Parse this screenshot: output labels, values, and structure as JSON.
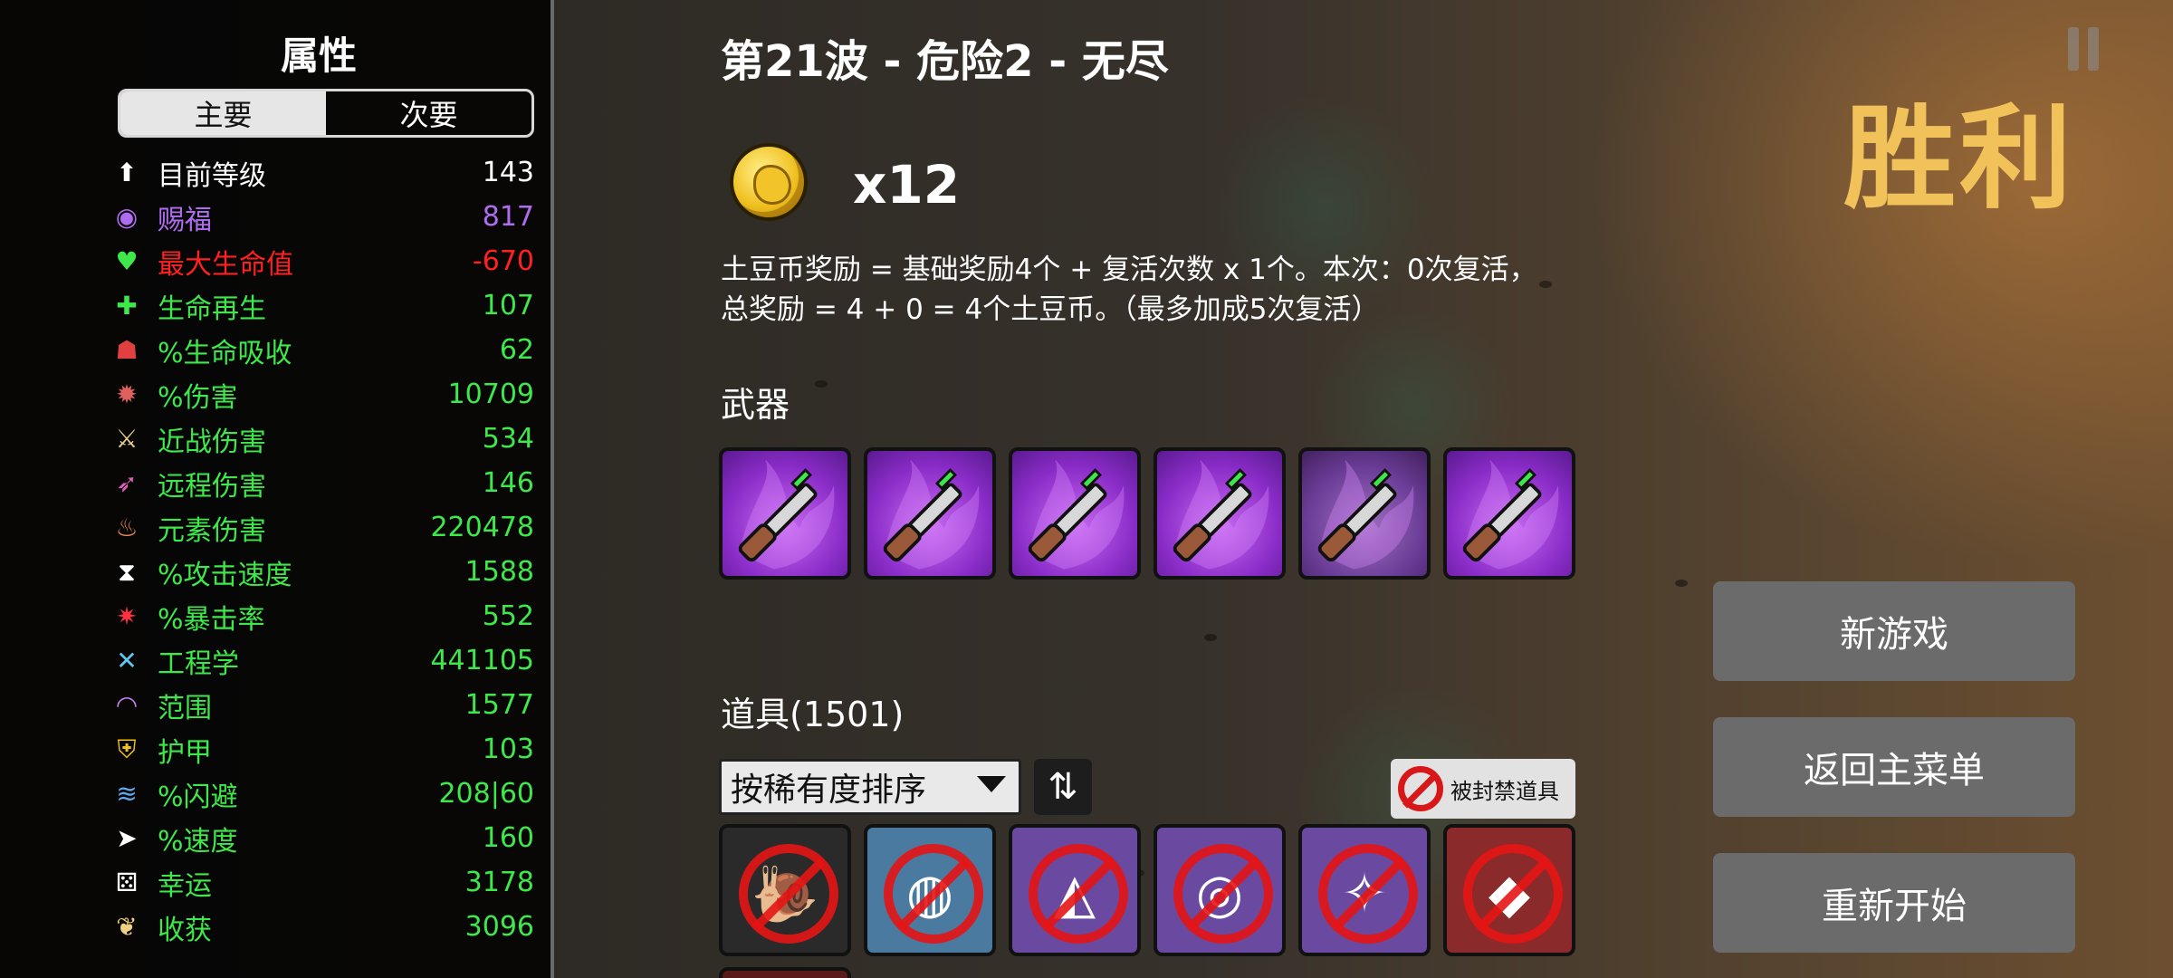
{
  "stats_panel": {
    "title": "属性",
    "tabs": [
      "主要",
      "次要"
    ],
    "stats": [
      {
        "icon": "level-icon",
        "glyph": "⬆",
        "name": "目前等级",
        "value": "143",
        "color": "#ffffff",
        "icon_color": "#ffffff"
      },
      {
        "icon": "eye-icon",
        "glyph": "◉",
        "name": "赐福",
        "value": "817",
        "color": "#b06cf0",
        "icon_color": "#b06cf0"
      },
      {
        "icon": "heart-icon",
        "glyph": "♥",
        "name": "最大生命值",
        "value": "-670",
        "color": "#ff2020",
        "icon_color": "#3ee84a"
      },
      {
        "icon": "regen-icon",
        "glyph": "✚",
        "name": "生命再生",
        "value": "107",
        "color": "#3ee84a",
        "icon_color": "#3ee84a"
      },
      {
        "icon": "lifesteal-icon",
        "glyph": "☗",
        "name": "%生命吸收",
        "value": "62",
        "color": "#3ee84a",
        "icon_color": "#e04040"
      },
      {
        "icon": "damage-icon",
        "glyph": "✹",
        "name": "%伤害",
        "value": "10709",
        "color": "#3ee84a",
        "icon_color": "#e06060"
      },
      {
        "icon": "melee-icon",
        "glyph": "⚔",
        "name": "近战伤害",
        "value": "534",
        "color": "#3ee84a",
        "icon_color": "#e8d090"
      },
      {
        "icon": "ranged-icon",
        "glyph": "➶",
        "name": "远程伤害",
        "value": "146",
        "color": "#3ee84a",
        "icon_color": "#e060c0"
      },
      {
        "icon": "elemental-icon",
        "glyph": "♨",
        "name": "元素伤害",
        "value": "220478",
        "color": "#3ee84a",
        "icon_color": "#f09050"
      },
      {
        "icon": "attack-speed-icon",
        "glyph": "⧗",
        "name": "%攻击速度",
        "value": "1588",
        "color": "#3ee84a",
        "icon_color": "#ffffff"
      },
      {
        "icon": "crit-icon",
        "glyph": "✷",
        "name": "%暴击率",
        "value": "552",
        "color": "#3ee84a",
        "icon_color": "#ff3040"
      },
      {
        "icon": "engineering-icon",
        "glyph": "✕",
        "name": "工程学",
        "value": "441105",
        "color": "#3ee84a",
        "icon_color": "#60c8f0"
      },
      {
        "icon": "range-icon",
        "glyph": "◠",
        "name": "范围",
        "value": "1577",
        "color": "#3ee84a",
        "icon_color": "#d080f0"
      },
      {
        "icon": "armor-icon",
        "glyph": "⛨",
        "name": "护甲",
        "value": "103",
        "color": "#3ee84a",
        "icon_color": "#f0c020"
      },
      {
        "icon": "dodge-icon",
        "glyph": "≋",
        "name": "%闪避",
        "value": "208|60",
        "color": "#3ee84a",
        "icon_color": "#60a8f0"
      },
      {
        "icon": "speed-icon",
        "glyph": "➤",
        "name": "%速度",
        "value": "160",
        "color": "#3ee84a",
        "icon_color": "#ffffff"
      },
      {
        "icon": "dice-icon",
        "glyph": "⚄",
        "name": "幸运",
        "value": "3178",
        "color": "#3ee84a",
        "icon_color": "#ffffff"
      },
      {
        "icon": "harvest-icon",
        "glyph": "❦",
        "name": "收获",
        "value": "3096",
        "color": "#3ee84a",
        "icon_color": "#f0d080"
      }
    ]
  },
  "main": {
    "wave_title": "第21波 - 危险2 - 无尽",
    "coin_count": "x12",
    "reward_line1": "土豆币奖励 = 基础奖励4个 + 复活次数 x 1个。本次：0次复活，",
    "reward_line2": "总奖励 = 4 + 0 = 4个土豆币。（最多加成5次复活）",
    "weapons_label": "武器",
    "weapons": [
      "knife-weapon",
      "knife-weapon",
      "knife-weapon",
      "knife-weapon",
      "knife-weapon",
      "knife-weapon"
    ],
    "items_label": "道具(1501)",
    "sort_label": "按稀有度排序",
    "sort_toggle_glyph": "⇅",
    "banned_label": "被封禁道具",
    "items": [
      {
        "icon": "snail-item-icon",
        "glyph": "🐌",
        "bg": "#2a2a2a"
      },
      {
        "icon": "bread-item-icon",
        "glyph": "◍",
        "bg": "#4a7aa0"
      },
      {
        "icon": "prism-item-icon",
        "glyph": "◭",
        "bg": "#6a4aa0"
      },
      {
        "icon": "orb-item-icon",
        "glyph": "◎",
        "bg": "#6a4aa0"
      },
      {
        "icon": "claw-item-icon",
        "glyph": "✧",
        "bg": "#6a4aa0"
      },
      {
        "icon": "rock-item-icon",
        "glyph": "◆",
        "bg": "#8a2a2a"
      }
    ]
  },
  "right": {
    "victory": "胜利",
    "buttons": [
      "新游戏",
      "返回主菜单",
      "重新开始"
    ]
  },
  "colors": {
    "victory": "#f2c25a",
    "weapon_purple": "#8a2cc8",
    "button_gray": "#6b6b6b"
  }
}
